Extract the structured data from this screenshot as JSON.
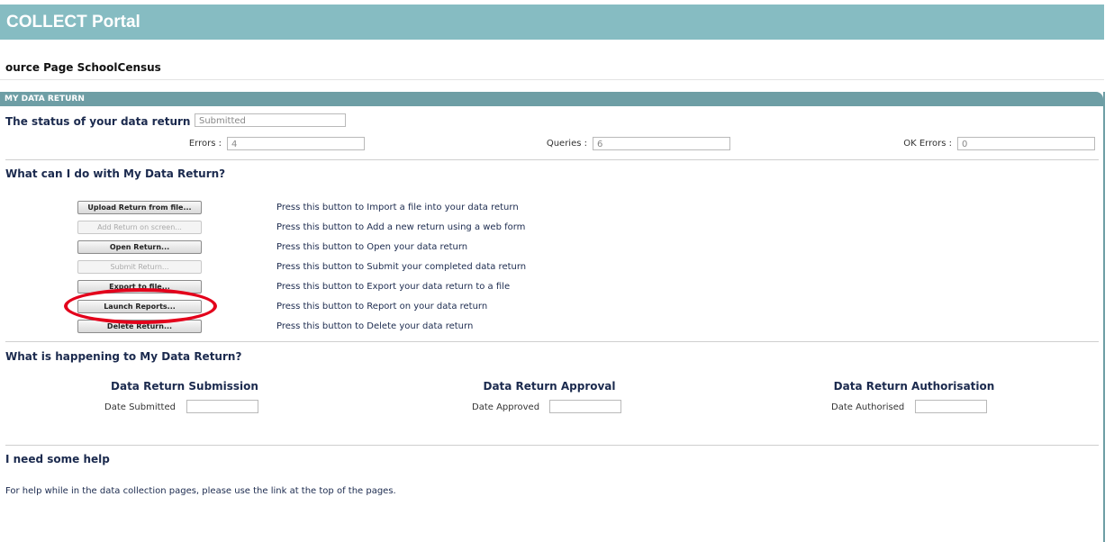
{
  "banner": {
    "title": "COLLECT Portal"
  },
  "source_page": "ource Page SchoolCensus",
  "panel": {
    "header": "MY DATA RETURN",
    "status_label": "The status of your data return :",
    "status_value": "Submitted",
    "errors_label": "Errors :",
    "errors_value": "4",
    "queries_label": "Queries :",
    "queries_value": "6",
    "ok_errors_label": "OK Errors :",
    "ok_errors_value": "0"
  },
  "actions": {
    "heading": "What can I do with My Data Return?",
    "items": [
      {
        "label": "Upload Return from file...",
        "desc": "Press this button to Import a file into your data return"
      },
      {
        "label": "Add Return on screen...",
        "desc": "Press this button to Add a new return using a web form"
      },
      {
        "label": "Open Return...",
        "desc": "Press this button to Open your data return"
      },
      {
        "label": "Submit Return...",
        "desc": "Press this button to Submit your completed data return"
      },
      {
        "label": "Export to file...",
        "desc": "Press this button to Export your data return to a file"
      },
      {
        "label": "Launch Reports...",
        "desc": "Press this button to Report on your data return"
      },
      {
        "label": "Delete Return...",
        "desc": "Press this button to Delete your data return"
      }
    ]
  },
  "happening": {
    "heading": "What is happening to My Data Return?",
    "submission_title": "Data Return Submission",
    "submission_label": "Date Submitted",
    "approval_title": "Data Return Approval",
    "approval_label": "Date Approved",
    "authorisation_title": "Data Return Authorisation",
    "authorisation_label": "Date Authorised"
  },
  "help": {
    "heading": "I need some help",
    "text": "For help while in the data collection pages, please use the link at the top of the pages."
  },
  "colors": {
    "banner": "#86bcc2",
    "panel_header": "#6e9ea5",
    "highlight": "#e3001b"
  }
}
